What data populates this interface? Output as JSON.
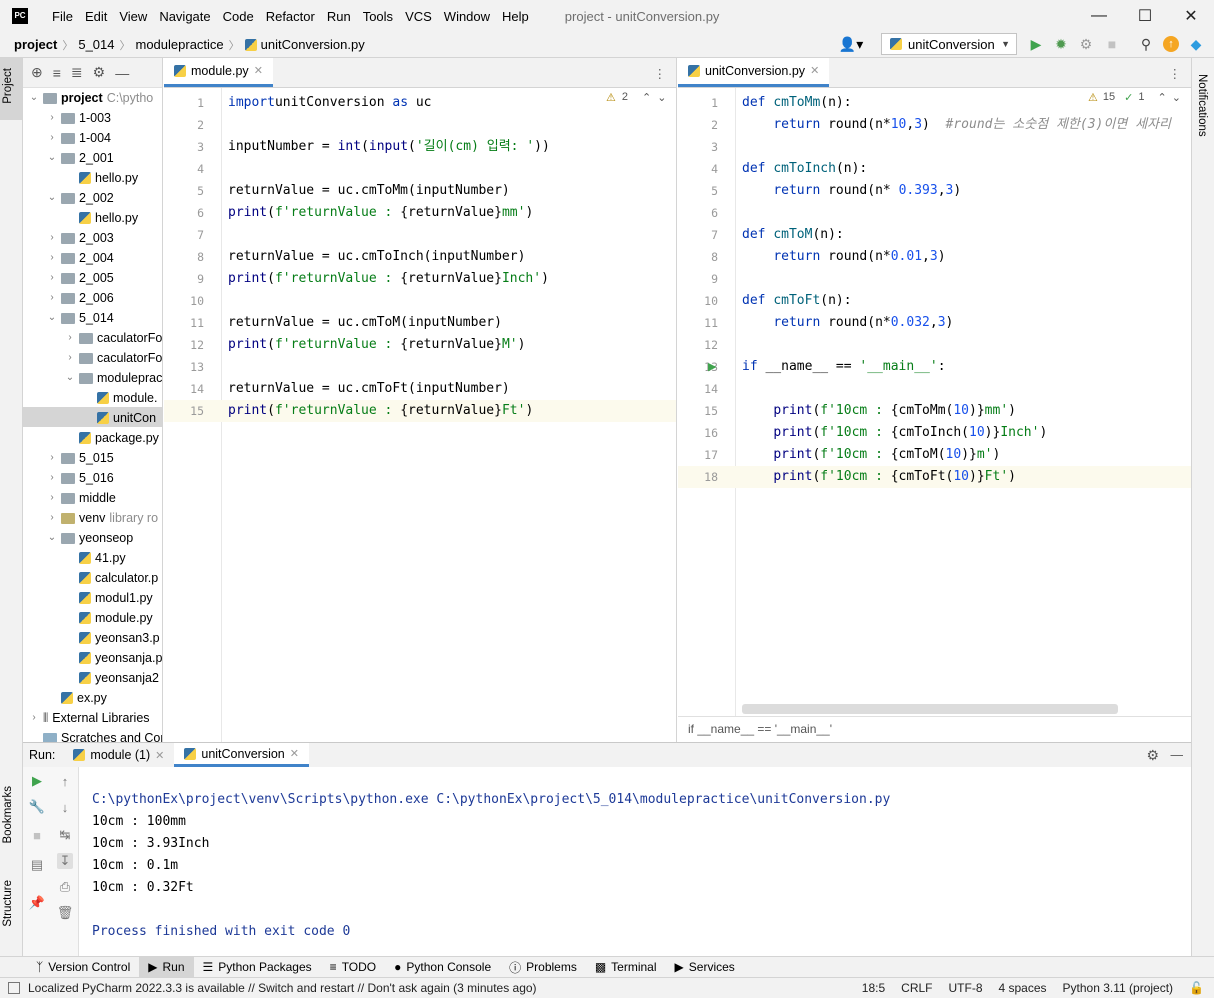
{
  "title_bar": {
    "logo": "PC",
    "menu": [
      "File",
      "Edit",
      "View",
      "Navigate",
      "Code",
      "Refactor",
      "Run",
      "Tools",
      "VCS",
      "Window",
      "Help"
    ],
    "window_title": "project - unitConversion.py"
  },
  "nav_bar": {
    "breadcrumbs": [
      "project",
      "5_014",
      "modulepractice",
      "unitConversion.py"
    ],
    "run_config": "unitConversion"
  },
  "left_tool_tabs": [
    "Project",
    "Bookmarks",
    "Structure"
  ],
  "right_tool_tabs": [
    "Notifications"
  ],
  "project_tree": {
    "root_label": "project",
    "root_path": "C:\\pytho",
    "rows": [
      {
        "label": "1-003",
        "depth": 1,
        "type": "folder",
        "arrow": "›"
      },
      {
        "label": "1-004",
        "depth": 1,
        "type": "folder",
        "arrow": "›"
      },
      {
        "label": "2_001",
        "depth": 1,
        "type": "folder",
        "arrow": "⌄"
      },
      {
        "label": "hello.py",
        "depth": 2,
        "type": "py",
        "arrow": ""
      },
      {
        "label": "2_002",
        "depth": 1,
        "type": "folder",
        "arrow": "⌄"
      },
      {
        "label": "hello.py",
        "depth": 2,
        "type": "py",
        "arrow": ""
      },
      {
        "label": "2_003",
        "depth": 1,
        "type": "folder",
        "arrow": "›"
      },
      {
        "label": "2_004",
        "depth": 1,
        "type": "folder",
        "arrow": "›"
      },
      {
        "label": "2_005",
        "depth": 1,
        "type": "folder",
        "arrow": "›"
      },
      {
        "label": "2_006",
        "depth": 1,
        "type": "folder",
        "arrow": "›"
      },
      {
        "label": "5_014",
        "depth": 1,
        "type": "folder",
        "arrow": "⌄"
      },
      {
        "label": "caculatorFo",
        "depth": 2,
        "type": "folder",
        "arrow": "›"
      },
      {
        "label": "caculatorFo",
        "depth": 2,
        "type": "folder",
        "arrow": "›"
      },
      {
        "label": "modulepract",
        "depth": 2,
        "type": "folder",
        "arrow": "⌄"
      },
      {
        "label": "module.",
        "depth": 3,
        "type": "py",
        "arrow": ""
      },
      {
        "label": "unitCon",
        "depth": 3,
        "type": "py",
        "arrow": ""
      },
      {
        "label": "package.py",
        "depth": 2,
        "type": "py",
        "arrow": ""
      },
      {
        "label": "5_015",
        "depth": 1,
        "type": "folder",
        "arrow": "›"
      },
      {
        "label": "5_016",
        "depth": 1,
        "type": "folder",
        "arrow": "›"
      },
      {
        "label": "middle",
        "depth": 1,
        "type": "folder",
        "arrow": "›"
      },
      {
        "label": "venv",
        "hint": "library ro",
        "depth": 1,
        "type": "venv",
        "arrow": "›"
      },
      {
        "label": "yeonseop",
        "depth": 1,
        "type": "folder",
        "arrow": "⌄"
      },
      {
        "label": "41.py",
        "depth": 2,
        "type": "py",
        "arrow": ""
      },
      {
        "label": "calculator.p",
        "depth": 2,
        "type": "py",
        "arrow": ""
      },
      {
        "label": "modul1.py",
        "depth": 2,
        "type": "py",
        "arrow": ""
      },
      {
        "label": "module.py",
        "depth": 2,
        "type": "py",
        "arrow": ""
      },
      {
        "label": "yeonsan3.p",
        "depth": 2,
        "type": "py",
        "arrow": ""
      },
      {
        "label": "yeonsanja.p",
        "depth": 2,
        "type": "py",
        "arrow": ""
      },
      {
        "label": "yeonsanja2",
        "depth": 2,
        "type": "py",
        "arrow": ""
      },
      {
        "label": "ex.py",
        "depth": 1,
        "type": "py",
        "arrow": ""
      },
      {
        "label": "External Libraries",
        "depth": 0,
        "type": "lib",
        "arrow": "›"
      },
      {
        "label": "Scratches and Con",
        "depth": 0,
        "type": "scratch",
        "arrow": ""
      }
    ]
  },
  "editor_left": {
    "tab": "module.py",
    "warnings": "2",
    "current_line": 15,
    "lines": [
      [
        [
          "kw",
          "import"
        ],
        [
          "",
          "unitConversion "
        ],
        [
          "kw",
          "as"
        ],
        [
          "",
          " uc"
        ]
      ],
      [],
      [
        [
          "",
          "inputNumber = "
        ],
        [
          "bi",
          "int"
        ],
        [
          "",
          "("
        ],
        [
          "bi",
          "input"
        ],
        [
          "",
          "("
        ],
        [
          "str",
          "'길이(cm) 입력: '"
        ],
        [
          "",
          "))"
        ]
      ],
      [],
      [
        [
          "",
          "returnValue = uc.cmToMm(inputNumber)"
        ]
      ],
      [
        [
          "bi",
          "print"
        ],
        [
          "",
          "("
        ],
        [
          "str",
          "f'returnValue : "
        ],
        [
          "",
          "{returnValue}"
        ],
        [
          "str",
          "mm'"
        ],
        [
          "",
          ")"
        ]
      ],
      [],
      [
        [
          "",
          "returnValue = uc.cmToInch(inputNumber)"
        ]
      ],
      [
        [
          "bi",
          "print"
        ],
        [
          "",
          "("
        ],
        [
          "str",
          "f'returnValue : "
        ],
        [
          "",
          "{returnValue}"
        ],
        [
          "str",
          "Inch'"
        ],
        [
          "",
          ")"
        ]
      ],
      [],
      [
        [
          "",
          "returnValue = uc.cmToM(inputNumber)"
        ]
      ],
      [
        [
          "bi",
          "print"
        ],
        [
          "",
          "("
        ],
        [
          "str",
          "f'returnValue : "
        ],
        [
          "",
          "{returnValue}"
        ],
        [
          "str",
          "M'"
        ],
        [
          "",
          ")"
        ]
      ],
      [],
      [
        [
          "",
          "returnValue = uc.cmToFt(inputNumber)"
        ]
      ],
      [
        [
          "bi",
          "print"
        ],
        [
          "",
          "("
        ],
        [
          "str",
          "f'returnValue : "
        ],
        [
          "",
          "{returnValue}"
        ],
        [
          "str",
          "Ft'"
        ],
        [
          "",
          ")"
        ]
      ]
    ]
  },
  "editor_right": {
    "tab": "unitConversion.py",
    "warnings": "15",
    "checks": "1",
    "current_line": 18,
    "run_gutter_line": 13,
    "breadcrumb": "if __name__ == '__main__'",
    "lines": [
      [
        [
          "kw",
          "def "
        ],
        [
          "fn",
          "cmToMm"
        ],
        [
          "",
          "(n):"
        ]
      ],
      [
        [
          "",
          "    "
        ],
        [
          "kw",
          "return "
        ],
        [
          "",
          "round(n*"
        ],
        [
          "num",
          "10"
        ],
        [
          "",
          ","
        ],
        [
          "num",
          "3"
        ],
        [
          "",
          ")  "
        ],
        [
          "cmt",
          "#round는 소숫점 제한(3)이면 세자리"
        ]
      ],
      [],
      [
        [
          "kw",
          "def "
        ],
        [
          "fn",
          "cmToInch"
        ],
        [
          "",
          "(n):"
        ]
      ],
      [
        [
          "",
          "    "
        ],
        [
          "kw",
          "return "
        ],
        [
          "",
          "round(n* "
        ],
        [
          "num",
          "0.393"
        ],
        [
          "",
          ","
        ],
        [
          "num",
          "3"
        ],
        [
          "",
          ")"
        ]
      ],
      [],
      [
        [
          "kw",
          "def "
        ],
        [
          "fn",
          "cmToM"
        ],
        [
          "",
          "(n):"
        ]
      ],
      [
        [
          "",
          "    "
        ],
        [
          "kw",
          "return "
        ],
        [
          "",
          "round(n*"
        ],
        [
          "num",
          "0.01"
        ],
        [
          "",
          ","
        ],
        [
          "num",
          "3"
        ],
        [
          "",
          ")"
        ]
      ],
      [],
      [
        [
          "kw",
          "def "
        ],
        [
          "fn",
          "cmToFt"
        ],
        [
          "",
          "(n):"
        ]
      ],
      [
        [
          "",
          "    "
        ],
        [
          "kw",
          "return "
        ],
        [
          "",
          "round(n*"
        ],
        [
          "num",
          "0.032"
        ],
        [
          "",
          ","
        ],
        [
          "num",
          "3"
        ],
        [
          "",
          ")"
        ]
      ],
      [],
      [
        [
          "kw",
          "if "
        ],
        [
          "",
          "__name__ == "
        ],
        [
          "str",
          "'__main__'"
        ],
        [
          "",
          ":"
        ]
      ],
      [],
      [
        [
          "",
          "    "
        ],
        [
          "bi",
          "print"
        ],
        [
          "",
          "("
        ],
        [
          "str",
          "f'10cm : "
        ],
        [
          "",
          "{cmToMm("
        ],
        [
          "num",
          "10"
        ],
        [
          "",
          ")}"
        ],
        [
          "str",
          "mm'"
        ],
        [
          "",
          ")"
        ]
      ],
      [
        [
          "",
          "    "
        ],
        [
          "bi",
          "print"
        ],
        [
          "",
          "("
        ],
        [
          "str",
          "f'10cm : "
        ],
        [
          "",
          "{cmToInch("
        ],
        [
          "num",
          "10"
        ],
        [
          "",
          ")}"
        ],
        [
          "str",
          "Inch'"
        ],
        [
          "",
          ")"
        ]
      ],
      [
        [
          "",
          "    "
        ],
        [
          "bi",
          "print"
        ],
        [
          "",
          "("
        ],
        [
          "str",
          "f'10cm : "
        ],
        [
          "",
          "{cmToM("
        ],
        [
          "num",
          "10"
        ],
        [
          "",
          ")}"
        ],
        [
          "str",
          "m'"
        ],
        [
          "",
          ")"
        ]
      ],
      [
        [
          "",
          "    "
        ],
        [
          "bi",
          "print"
        ],
        [
          "",
          "("
        ],
        [
          "str",
          "f'10cm : "
        ],
        [
          "",
          "{cmToFt("
        ],
        [
          "num",
          "10"
        ],
        [
          "",
          ")}"
        ],
        [
          "str",
          "Ft'"
        ],
        [
          "",
          ")"
        ]
      ]
    ]
  },
  "run_panel": {
    "label": "Run:",
    "tabs": [
      "module (1)",
      "unitConversion"
    ],
    "active_tab": 1,
    "command": "C:\\pythonEx\\project\\venv\\Scripts\\python.exe C:\\pythonEx\\project\\5_014\\modulepractice\\unitConversion.py",
    "output": [
      "10cm : 100mm",
      "10cm : 3.93Inch",
      "10cm : 0.1m",
      "10cm : 0.32Ft"
    ],
    "exit_message": "Process finished with exit code 0"
  },
  "bottom_tabs": [
    "Version Control",
    "Run",
    "Python Packages",
    "TODO",
    "Python Console",
    "Problems",
    "Terminal",
    "Services"
  ],
  "bottom_active": "Run",
  "status_bar": {
    "message": "Localized PyCharm 2022.3.3 is available // Switch and restart // Don't ask again (3 minutes ago)",
    "position": "18:5",
    "line_sep": "CRLF",
    "encoding": "UTF-8",
    "indent": "4 spaces",
    "interpreter": "Python 3.11 (project)"
  },
  "colors": {
    "accent": "#4083c9",
    "keyword": "#0033b3",
    "string": "#067d17",
    "number": "#1750eb",
    "console_blue": "#1d3997"
  }
}
